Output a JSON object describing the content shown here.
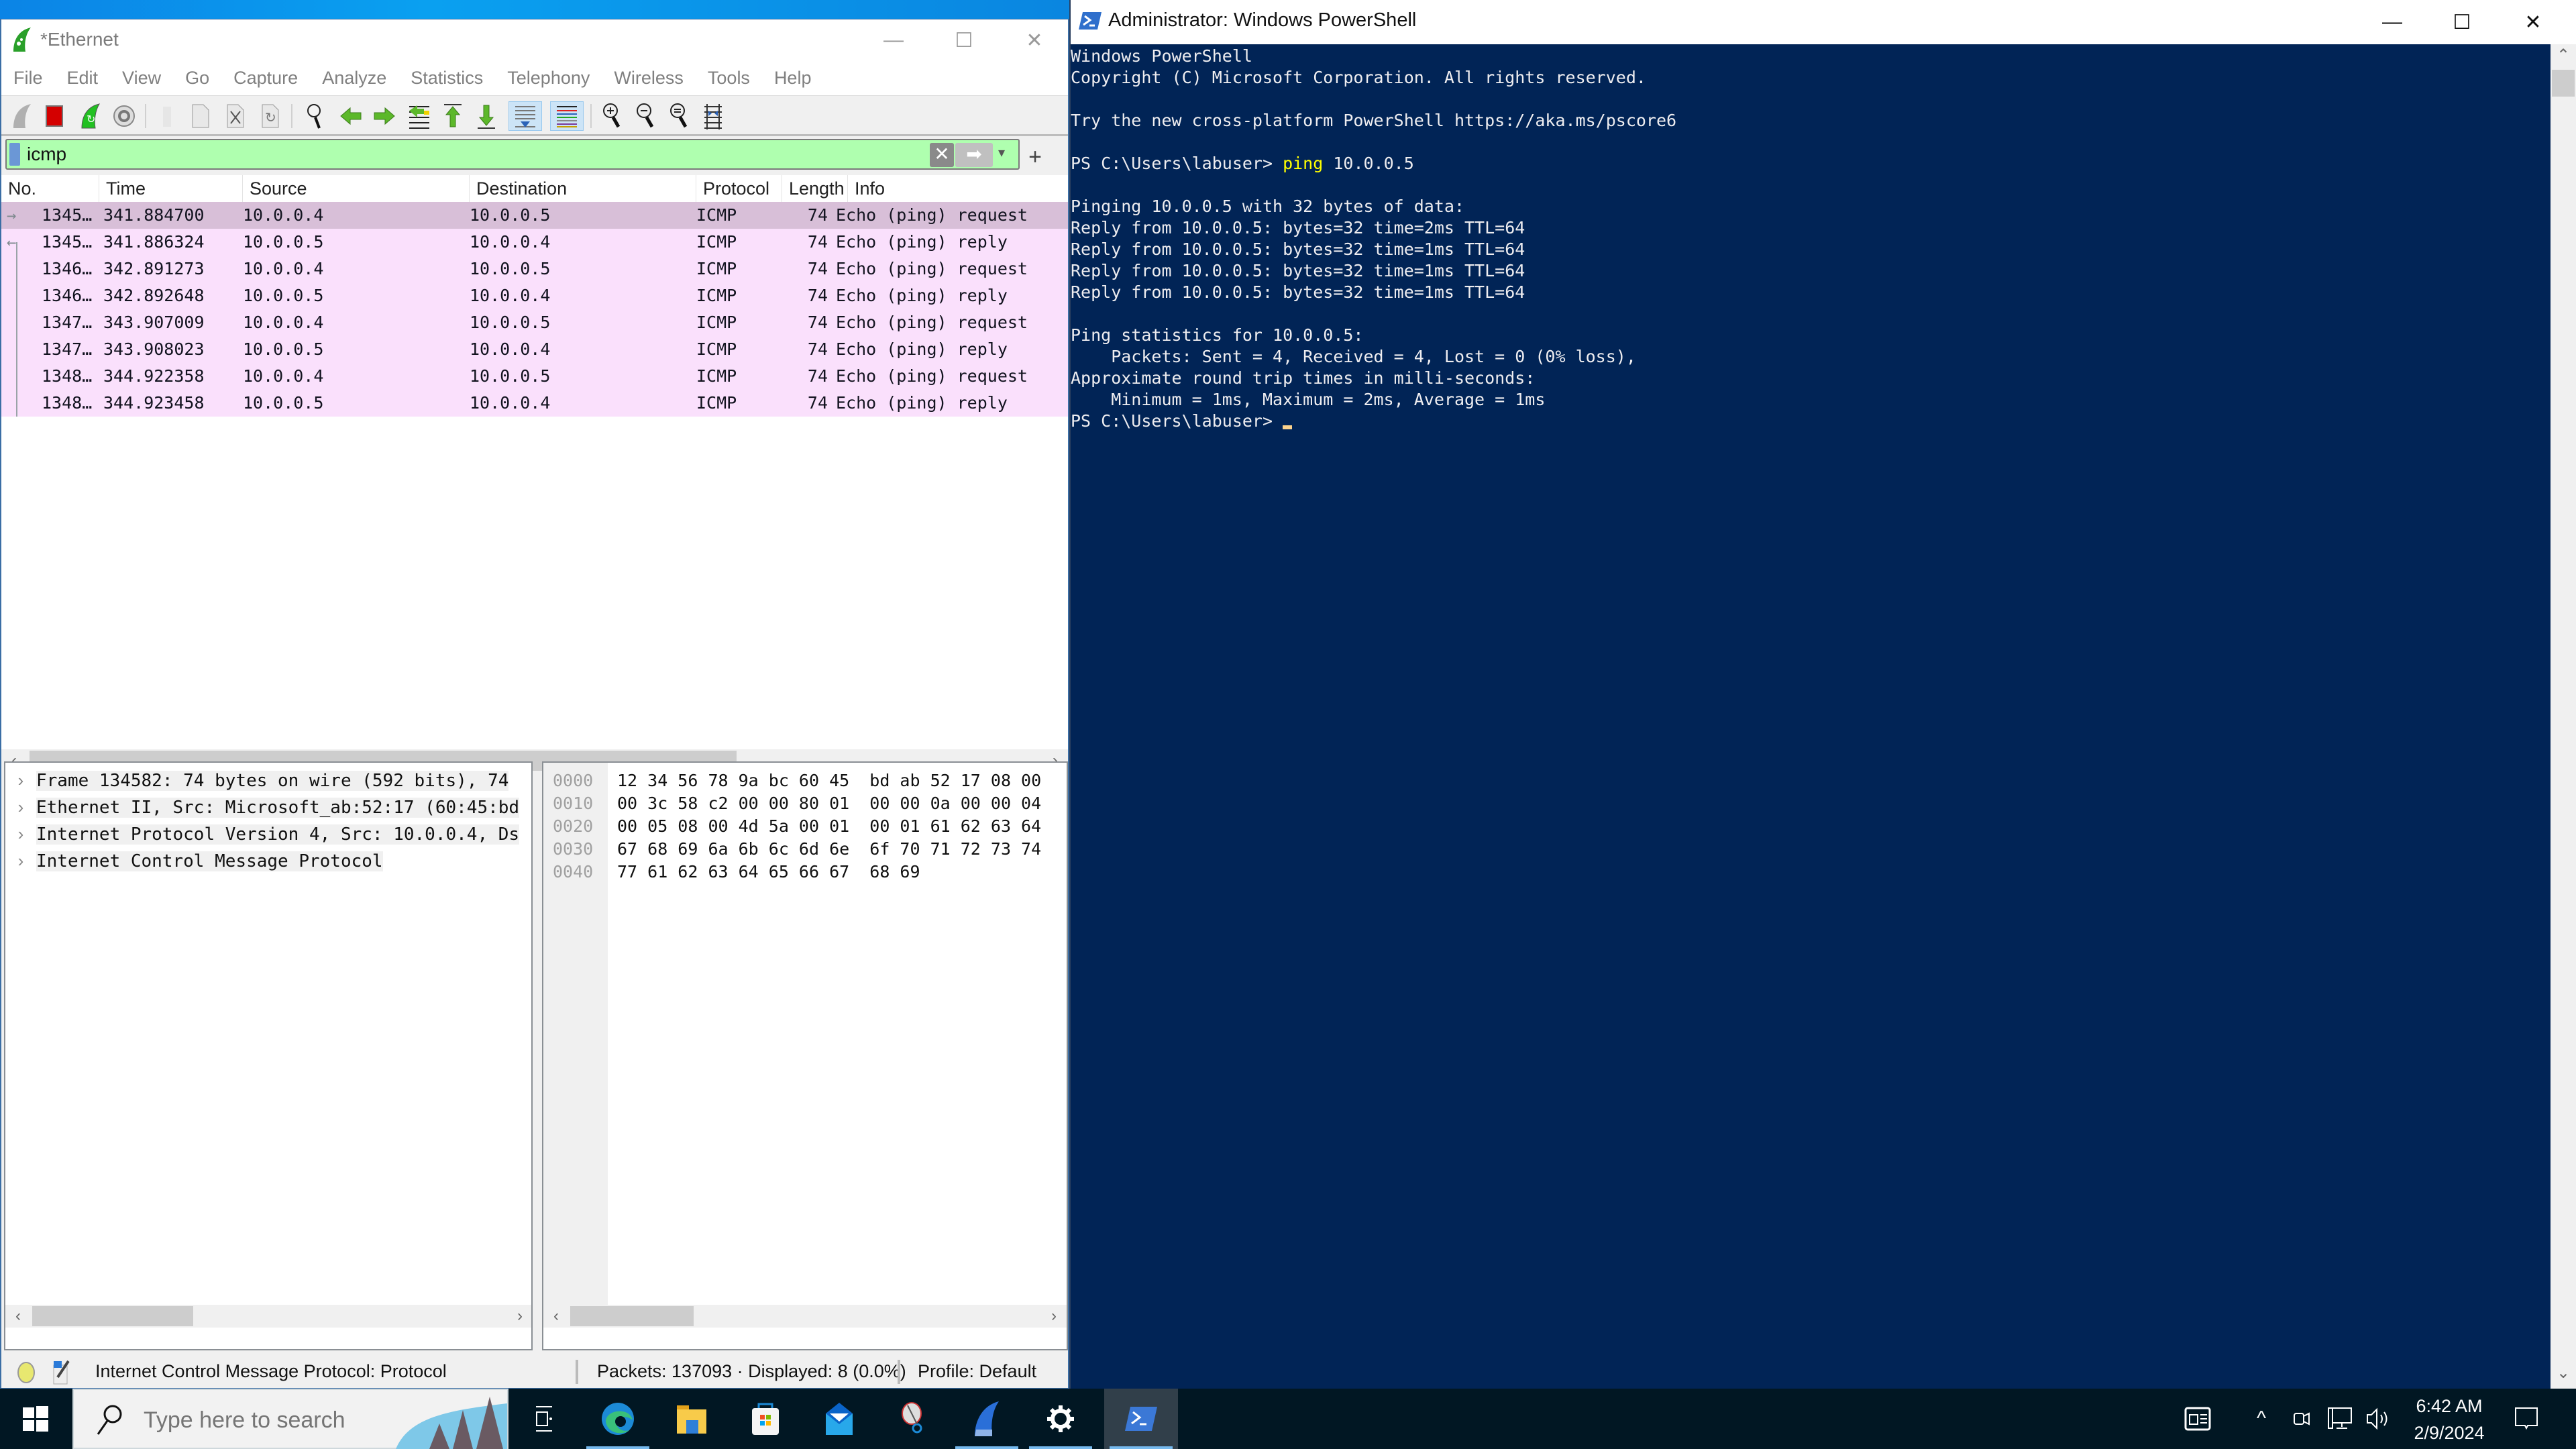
{
  "wireshark": {
    "title": "*Ethernet",
    "window_controls": {
      "minimize": "—",
      "maximize": "☐",
      "close": "✕"
    },
    "menu": [
      "File",
      "Edit",
      "View",
      "Go",
      "Capture",
      "Analyze",
      "Statistics",
      "Telephony",
      "Wireless",
      "Tools",
      "Help"
    ],
    "toolbar": [
      {
        "name": "start-capture-icon"
      },
      {
        "name": "stop-capture-icon"
      },
      {
        "name": "restart-capture-icon"
      },
      {
        "name": "capture-options-icon"
      },
      {
        "name": "open-file-icon"
      },
      {
        "name": "save-file-icon"
      },
      {
        "name": "close-file-icon"
      },
      {
        "name": "reload-file-icon"
      },
      {
        "name": "find-packet-icon"
      },
      {
        "name": "go-back-icon"
      },
      {
        "name": "go-forward-icon"
      },
      {
        "name": "go-to-packet-icon"
      },
      {
        "name": "first-packet-icon"
      },
      {
        "name": "last-packet-icon"
      },
      {
        "name": "autoscroll-icon",
        "active": true
      },
      {
        "name": "colorize-icon",
        "active": true
      },
      {
        "name": "zoom-in-icon"
      },
      {
        "name": "zoom-out-icon"
      },
      {
        "name": "normal-size-icon"
      },
      {
        "name": "resize-columns-icon"
      }
    ],
    "filter": {
      "value": "icmp",
      "clear_glyph": "✕",
      "apply_glyph": "➡",
      "dropdown_glyph": "▾",
      "add_glyph": "+"
    },
    "packet_list": {
      "columns": [
        "No.",
        "Time",
        "Source",
        "Destination",
        "Protocol",
        "Length",
        "Info"
      ],
      "rows": [
        {
          "no": "1345…",
          "time": "341.884700",
          "source": "10.0.0.4",
          "destination": "10.0.0.5",
          "protocol": "ICMP",
          "length": "74",
          "info": "Echo (ping) request",
          "selected": true,
          "rel": "→"
        },
        {
          "no": "1345…",
          "time": "341.886324",
          "source": "10.0.0.5",
          "destination": "10.0.0.4",
          "protocol": "ICMP",
          "length": "74",
          "info": "Echo (ping) reply",
          "rel": "←"
        },
        {
          "no": "1346…",
          "time": "342.891273",
          "source": "10.0.0.4",
          "destination": "10.0.0.5",
          "protocol": "ICMP",
          "length": "74",
          "info": "Echo (ping) request"
        },
        {
          "no": "1346…",
          "time": "342.892648",
          "source": "10.0.0.5",
          "destination": "10.0.0.4",
          "protocol": "ICMP",
          "length": "74",
          "info": "Echo (ping) reply"
        },
        {
          "no": "1347…",
          "time": "343.907009",
          "source": "10.0.0.4",
          "destination": "10.0.0.5",
          "protocol": "ICMP",
          "length": "74",
          "info": "Echo (ping) request"
        },
        {
          "no": "1347…",
          "time": "343.908023",
          "source": "10.0.0.5",
          "destination": "10.0.0.4",
          "protocol": "ICMP",
          "length": "74",
          "info": "Echo (ping) reply"
        },
        {
          "no": "1348…",
          "time": "344.922358",
          "source": "10.0.0.4",
          "destination": "10.0.0.5",
          "protocol": "ICMP",
          "length": "74",
          "info": "Echo (ping) request"
        },
        {
          "no": "1348…",
          "time": "344.923458",
          "source": "10.0.0.5",
          "destination": "10.0.0.4",
          "protocol": "ICMP",
          "length": "74",
          "info": "Echo (ping) reply"
        }
      ]
    },
    "details": [
      "Frame 134582: 74 bytes on wire (592 bits), 74",
      "Ethernet II, Src: Microsoft_ab:52:17 (60:45:bd",
      "Internet Protocol Version 4, Src: 10.0.0.4, Ds",
      "Internet Control Message Protocol"
    ],
    "details_expander": "›",
    "bytes": [
      {
        "offset": "0000",
        "hex": "12 34 56 78 9a bc 60 45  bd ab 52 17 08 00"
      },
      {
        "offset": "0010",
        "hex": "00 3c 58 c2 00 00 80 01  00 00 0a 00 00 04"
      },
      {
        "offset": "0020",
        "hex": "00 05 08 00 4d 5a 00 01  00 01 61 62 63 64"
      },
      {
        "offset": "0030",
        "hex": "67 68 69 6a 6b 6c 6d 6e  6f 70 71 72 73 74"
      },
      {
        "offset": "0040",
        "hex": "77 61 62 63 64 65 66 67  68 69"
      }
    ],
    "scroll_arrows": {
      "left": "‹",
      "right": "›"
    },
    "status": {
      "field_info": "Internet Control Message Protocol: Protocol",
      "packets": "Packets: 137093 · Displayed: 8 (0.0%)",
      "profile": "Profile: Default"
    }
  },
  "powershell": {
    "title": "Administrator: Windows PowerShell",
    "window_controls": {
      "minimize": "—",
      "maximize": "☐",
      "close": "✕"
    },
    "lines": [
      "Windows PowerShell",
      "Copyright (C) Microsoft Corporation. All rights reserved.",
      "",
      "Try the new cross-platform PowerShell https://aka.ms/pscore6",
      "",
      {
        "prompt": "PS C:\\Users\\labuser> ",
        "cmd": "ping",
        "args": " 10.0.0.5"
      },
      "",
      "Pinging 10.0.0.5 with 32 bytes of data:",
      "Reply from 10.0.0.5: bytes=32 time=2ms TTL=64",
      "Reply from 10.0.0.5: bytes=32 time=1ms TTL=64",
      "Reply from 10.0.0.5: bytes=32 time=1ms TTL=64",
      "Reply from 10.0.0.5: bytes=32 time=1ms TTL=64",
      "",
      "Ping statistics for 10.0.0.5:",
      "    Packets: Sent = 4, Received = 4, Lost = 0 (0% loss),",
      "Approximate round trip times in milli-seconds:",
      "    Minimum = 1ms, Maximum = 2ms, Average = 1ms",
      {
        "prompt": "PS C:\\Users\\labuser> ",
        "cursor": true
      }
    ],
    "scroll_up": "⌃",
    "scroll_down": "⌄"
  },
  "taskbar": {
    "search_placeholder": "Type here to search",
    "apps": [
      {
        "name": "task-view-icon"
      },
      {
        "name": "edge-icon",
        "running": true
      },
      {
        "name": "file-explorer-icon"
      },
      {
        "name": "microsoft-store-icon"
      },
      {
        "name": "mail-icon"
      },
      {
        "name": "snipping-tool-icon"
      },
      {
        "name": "wireshark-icon",
        "running": true
      },
      {
        "name": "settings-icon",
        "running": true
      },
      {
        "name": "powershell-icon",
        "running": true,
        "active": true
      }
    ],
    "tray": {
      "chevron": "^",
      "time": "6:42 AM",
      "date": "2/9/2024"
    }
  },
  "colors": {
    "ps_background": "#012456",
    "ps_command": "#ffff00",
    "ws_row_bg": "#fae0fc",
    "ws_row_selected": "#d8bfd8",
    "filter_valid": "#afffaf",
    "taskbar": "#011723"
  }
}
